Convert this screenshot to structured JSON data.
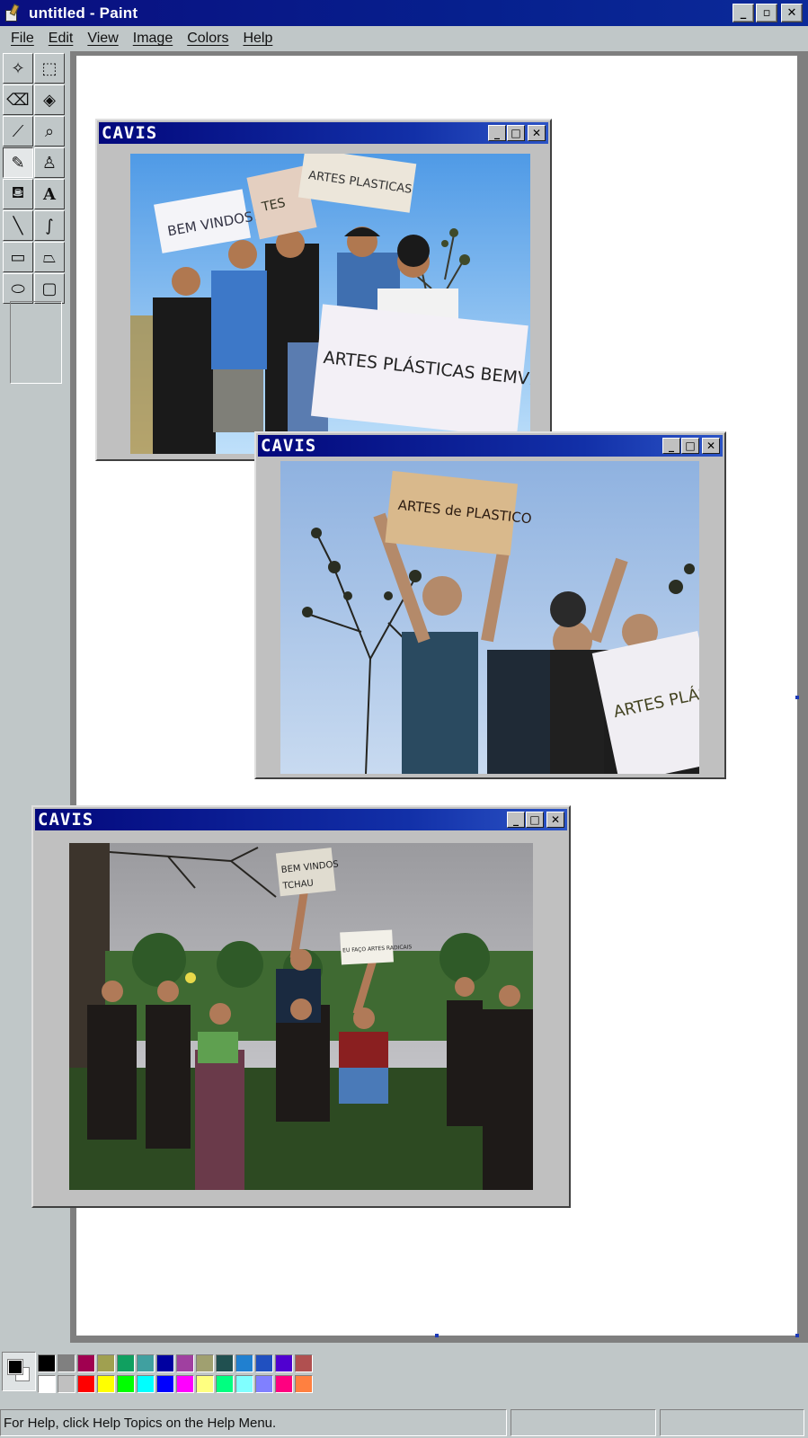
{
  "window": {
    "title": "untitled - Paint",
    "minimize": "_",
    "restore": "▫",
    "close": "✕"
  },
  "menu": [
    "File",
    "Edit",
    "View",
    "Image",
    "Colors",
    "Help"
  ],
  "tools": [
    {
      "name": "free-form-select-tool",
      "glyph": "✧"
    },
    {
      "name": "rect-select-tool",
      "glyph": "⬚"
    },
    {
      "name": "eraser-tool",
      "glyph": "⌫"
    },
    {
      "name": "fill-tool",
      "glyph": "◈"
    },
    {
      "name": "pick-color-tool",
      "glyph": "⟋"
    },
    {
      "name": "magnifier-tool",
      "glyph": "⌕"
    },
    {
      "name": "pencil-tool",
      "glyph": "✎"
    },
    {
      "name": "brush-tool",
      "glyph": "♙"
    },
    {
      "name": "airbrush-tool",
      "glyph": "⛾"
    },
    {
      "name": "text-tool",
      "glyph": "A"
    },
    {
      "name": "line-tool",
      "glyph": "╲"
    },
    {
      "name": "curve-tool",
      "glyph": "∫"
    },
    {
      "name": "rectangle-tool",
      "glyph": "▭"
    },
    {
      "name": "polygon-tool",
      "glyph": "⏢"
    },
    {
      "name": "ellipse-tool",
      "glyph": "⬭"
    },
    {
      "name": "rounded-rect-tool",
      "glyph": "▢"
    }
  ],
  "active_tool": "pencil-tool",
  "inner_windows": [
    {
      "title": "CAVIS",
      "minimize": "_",
      "maximize": "□",
      "close": "✕",
      "photo_signs": [
        "BEM VINDOS!",
        "TES",
        "ARTES PLASTICAS",
        "ARTES PLÁSTICAS BEMVINDOS"
      ]
    },
    {
      "title": "CAVIS",
      "minimize": "_",
      "maximize": "□",
      "close": "✕",
      "photo_signs": [
        "ARTES de PLASTICO",
        "ARTES PLÁS"
      ]
    },
    {
      "title": "CAVIS",
      "minimize": "_",
      "maximize": "□",
      "close": "✕",
      "photo_signs": [
        "BEM VINDOS",
        "TCHAU",
        "EU FAÇO ARTES RADICAIS"
      ]
    }
  ],
  "palette": {
    "foreground": "#000000",
    "background": "#ffffff",
    "row1": [
      "#000000",
      "#808080",
      "#a00050",
      "#a0a050",
      "#10a060",
      "#40a0a0",
      "#0000a0",
      "#a040a0",
      "#a0a070",
      "#205050",
      "#2080d0",
      "#2050c0",
      "#5000d0",
      "#b05050"
    ],
    "row2": [
      "#ffffff",
      "#c0c0c0",
      "#ff0000",
      "#ffff00",
      "#00ff00",
      "#00ffff",
      "#0000ff",
      "#ff00ff",
      "#ffff80",
      "#00ff80",
      "#80ffff",
      "#8080ff",
      "#ff0080",
      "#ff8040"
    ]
  },
  "status": {
    "help_text": "For Help, click Help Topics on the Help Menu.",
    "coords": "",
    "size": ""
  }
}
